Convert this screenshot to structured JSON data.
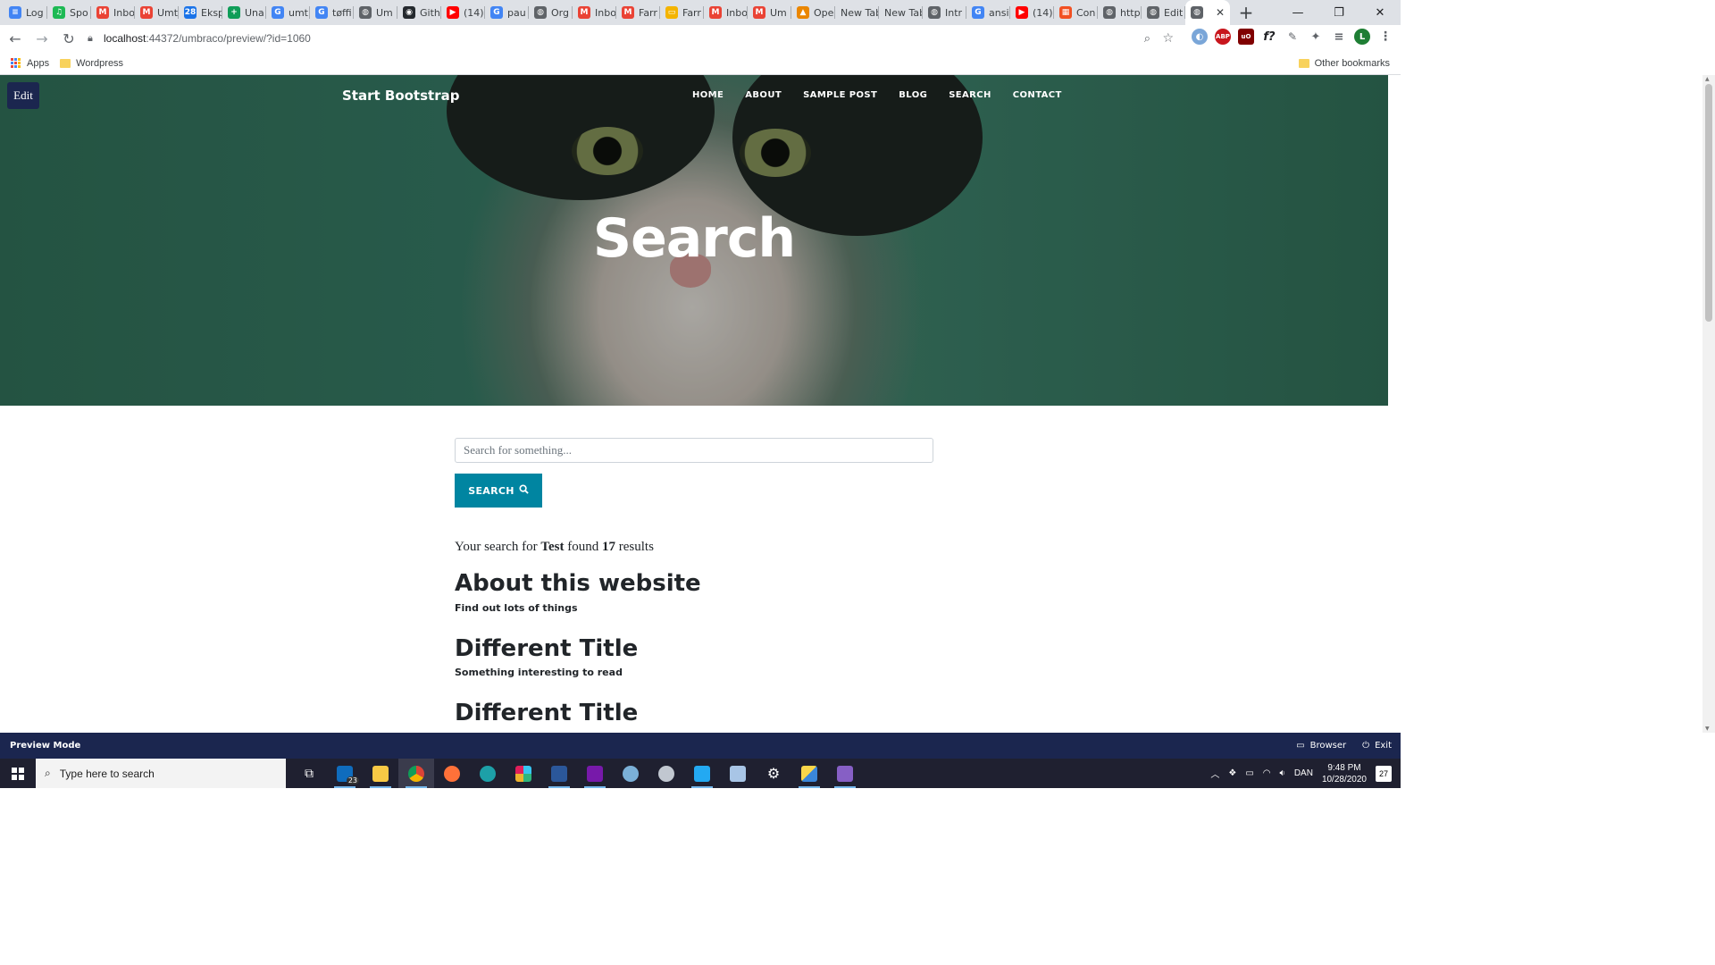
{
  "browser": {
    "tabs": [
      {
        "label": "Log",
        "color": "#4285f4",
        "glyph": "≡"
      },
      {
        "label": "Spo",
        "color": "#1db954",
        "glyph": "♫"
      },
      {
        "label": "Inbo",
        "color": "#ea4335",
        "glyph": "M"
      },
      {
        "label": "Umt",
        "color": "#ea4335",
        "glyph": "M"
      },
      {
        "label": "Eksp",
        "color": "#1a73e8",
        "glyph": "28"
      },
      {
        "label": "Una",
        "color": "#0f9d58",
        "glyph": "+"
      },
      {
        "label": "umt",
        "color": "#4285f4",
        "glyph": "G"
      },
      {
        "label": "tøffi",
        "color": "#4285f4",
        "glyph": "G"
      },
      {
        "label": "Um",
        "color": "#5f6368",
        "glyph": "◍"
      },
      {
        "label": "Gith",
        "color": "#24292e",
        "glyph": "◉"
      },
      {
        "label": "(14)",
        "color": "#ff0000",
        "glyph": "▶"
      },
      {
        "label": "pau",
        "color": "#4285f4",
        "glyph": "G"
      },
      {
        "label": "Org",
        "color": "#5f6368",
        "glyph": "◍"
      },
      {
        "label": "Inbo",
        "color": "#ea4335",
        "glyph": "M"
      },
      {
        "label": "Farr",
        "color": "#ea4335",
        "glyph": "M"
      },
      {
        "label": "Farr",
        "color": "#f4b400",
        "glyph": "▭"
      },
      {
        "label": "Inbo",
        "color": "#ea4335",
        "glyph": "M"
      },
      {
        "label": "Um",
        "color": "#ea4335",
        "glyph": "M"
      },
      {
        "label": "Ope",
        "color": "#ea8600",
        "glyph": "▲"
      },
      {
        "label": "New Tab",
        "color": "",
        "glyph": ""
      },
      {
        "label": "New Tab",
        "color": "",
        "glyph": ""
      },
      {
        "label": "Intr",
        "color": "#5f6368",
        "glyph": "◍"
      },
      {
        "label": "ansi",
        "color": "#4285f4",
        "glyph": "G"
      },
      {
        "label": "(14)",
        "color": "#ff0000",
        "glyph": "▶"
      },
      {
        "label": "Con",
        "color": "#f25022",
        "glyph": "▦"
      },
      {
        "label": "http",
        "color": "#5f6368",
        "glyph": "◍"
      },
      {
        "label": "Edit",
        "color": "#5f6368",
        "glyph": "◍"
      }
    ],
    "active_tab_close": "✕",
    "new_tab": "+",
    "window_controls": {
      "minimize": "—",
      "restore": "❐",
      "close": "✕"
    },
    "url_host": "localhost",
    "url_rest": ":44372/umbraco/preview/?id=1060",
    "profile_initial": "L",
    "bookmarks": {
      "apps": "Apps",
      "wordpress": "Wordpress",
      "other": "Other bookmarks"
    }
  },
  "site": {
    "edit_button": "Edit",
    "brand": "Start Bootstrap",
    "nav": [
      "HOME",
      "ABOUT",
      "SAMPLE POST",
      "BLOG",
      "SEARCH",
      "CONTACT"
    ],
    "hero_title": "Search",
    "search_placeholder": "Search for something...",
    "search_button": "SEARCH",
    "summary": {
      "prefix": "Your search for",
      "term": "Test",
      "middle": "found",
      "count": "17",
      "suffix": "results"
    },
    "results": [
      {
        "title": "About this website",
        "subtitle": "Find out lots of things"
      },
      {
        "title": "Different Title",
        "subtitle": "Something interesting to read"
      },
      {
        "title": "Different Title",
        "subtitle": ""
      }
    ]
  },
  "preview_bar": {
    "label": "Preview Mode",
    "browser": "Browser",
    "exit": "Exit"
  },
  "taskbar": {
    "search_placeholder": "Type here to search",
    "mail_badge": "23",
    "language": "DAN",
    "time": "9:48 PM",
    "date": "10/28/2020",
    "notifications": "27"
  },
  "colors": {
    "umbraco_navy": "#1b264f",
    "accent_teal": "#0085a1",
    "hero_green": "#347561"
  }
}
